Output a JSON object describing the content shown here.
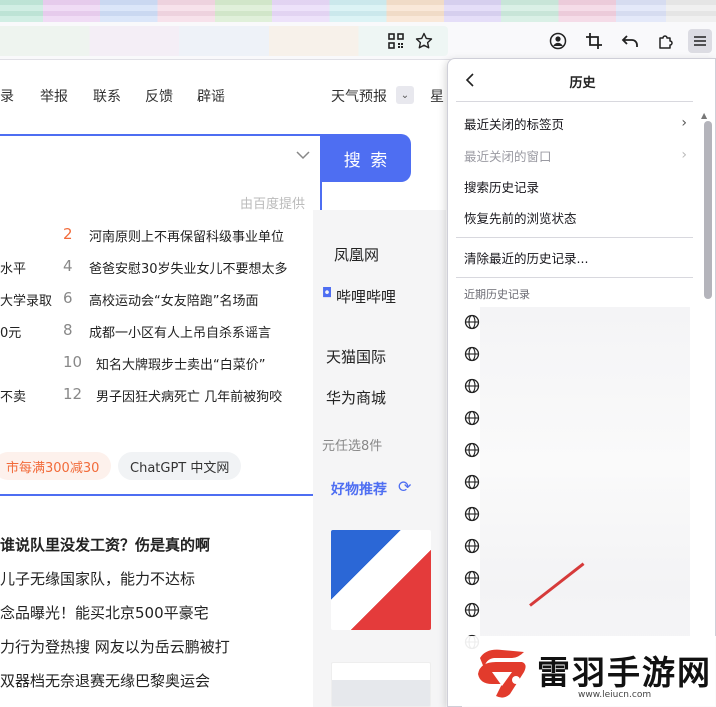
{
  "browser": {
    "toolbar_icons": [
      "qr-code-icon",
      "star-icon",
      "account-icon",
      "screenshot-icon",
      "undo-icon",
      "extensions-icon",
      "menu-icon"
    ]
  },
  "page": {
    "nav": [
      "录",
      "举报",
      "联系",
      "反馈",
      "辟谣",
      "天气预报",
      "星"
    ],
    "search_button": "搜 索",
    "baidu_note": "由百度提供",
    "hot_left": [
      "水平",
      "大学录取",
      "0元",
      "不卖"
    ],
    "hot_items": [
      {
        "num": "2",
        "text": "河南原则上不再保留科级事业单位"
      },
      {
        "num": "4",
        "text": "爸爸安慰30岁失业女儿不要想太多"
      },
      {
        "num": "6",
        "text": "高校运动会“女友陪跑”名场面"
      },
      {
        "num": "8",
        "text": "成都一小区有人上吊自杀系谣言"
      },
      {
        "num": "10",
        "text": "知名大牌瑕步士卖出“白菜价”"
      },
      {
        "num": "12",
        "text": "男子因狂犬病死亡 几年前被狗咬"
      }
    ],
    "chips": [
      "市每满300减30",
      "ChatGPT 中文网"
    ],
    "sites": [
      "凤凰网",
      "哔哩哔哩",
      "天猫国际",
      "华为商城",
      "元任选8件"
    ],
    "rec_title": "好物推荐",
    "news": [
      "谁说队里没发工资？伤是真的啊",
      "儿子无缘国家队，能力不达标",
      "念品曝光！能买北京500平豪宅",
      "力行为登热搜 网友以为岳云鹏被打",
      "双器档无奈退赛无缘巴黎奥运会"
    ]
  },
  "history_panel": {
    "title": "历史",
    "items": [
      {
        "label": "最近关闭的标签页",
        "arrow": "›",
        "disabled": false
      },
      {
        "label": "最近关闭的窗口",
        "arrow": "›",
        "disabled": true
      },
      {
        "label": "搜索历史记录",
        "disabled": false
      },
      {
        "label": "恢复先前的浏览状态",
        "disabled": false
      },
      {
        "label": "清除最近的历史记录...",
        "disabled": false
      }
    ],
    "section_label": "近期历史记录",
    "entry_count": 11
  },
  "watermark": {
    "name": "雷羽手游网",
    "url": "www.leiucn.com"
  },
  "colors": {
    "accent": "#4e6ef2",
    "hot_highlight": "#f26b3a",
    "logo_red": "#e23b2c"
  }
}
